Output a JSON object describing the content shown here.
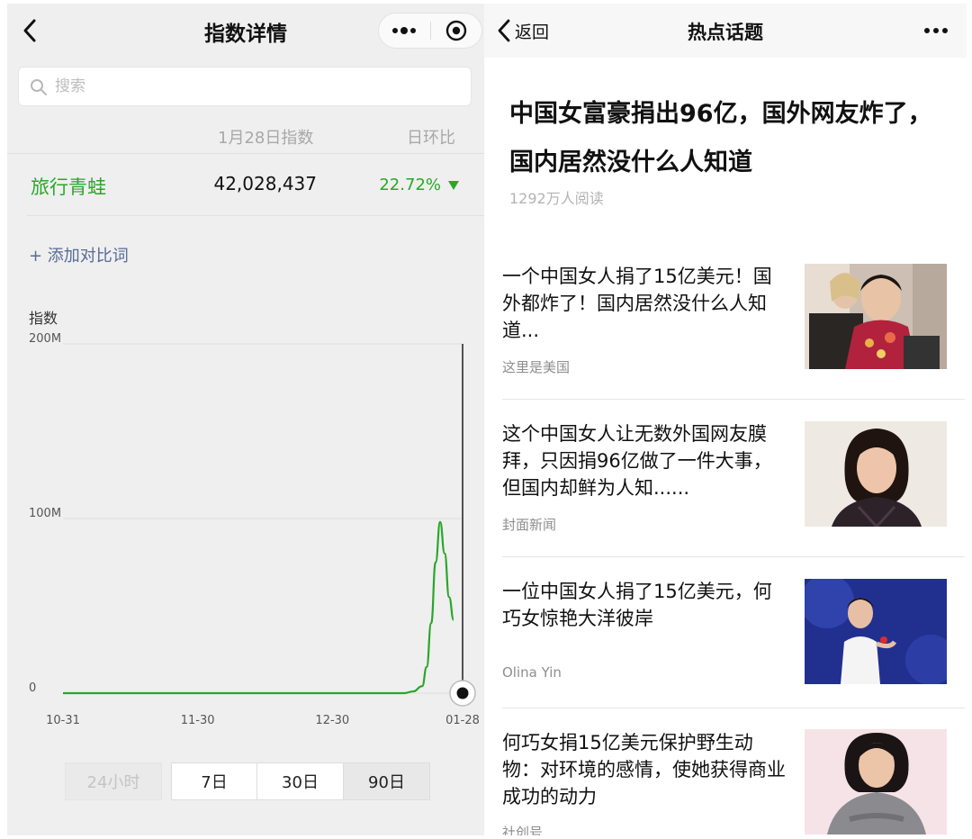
{
  "left": {
    "title": "指数详情",
    "search_placeholder": "搜索",
    "columns": {
      "date": "1月28日指数",
      "ratio": "日环比"
    },
    "row": {
      "term": "旅行青蛙",
      "index": "42,028,437",
      "ratio": "22.72%"
    },
    "add_compare": "+ 添加对比词",
    "y_axis_title": "指数",
    "range_buttons": [
      {
        "label": "24小时",
        "state": "disabled"
      },
      {
        "label": "7日",
        "state": "normal"
      },
      {
        "label": "30日",
        "state": "normal"
      },
      {
        "label": "90日",
        "state": "selected"
      }
    ]
  },
  "chart_data": {
    "type": "line",
    "ylabel": "指数",
    "ylim": [
      0,
      200000000
    ],
    "y_ticks": [
      {
        "label": "200M",
        "value": 200000000
      },
      {
        "label": "100M",
        "value": 100000000
      },
      {
        "label": "0",
        "value": 0
      }
    ],
    "x_ticks": [
      {
        "label": "10-31",
        "day": 0
      },
      {
        "label": "11-30",
        "day": 30
      },
      {
        "label": "12-30",
        "day": 60
      },
      {
        "label": "01-28",
        "day": 89
      }
    ],
    "xlim": [
      0,
      89
    ],
    "series": [
      {
        "color": "#2aa62a",
        "points": [
          [
            0,
            0
          ],
          [
            70,
            0
          ],
          [
            76,
            0
          ],
          [
            78,
            1000000
          ],
          [
            80,
            4000000
          ],
          [
            81,
            15000000
          ],
          [
            82,
            40000000
          ],
          [
            83,
            75000000
          ],
          [
            84,
            98000000
          ],
          [
            85,
            80000000
          ],
          [
            86,
            55000000
          ],
          [
            87,
            42000000
          ]
        ]
      }
    ],
    "highlight_day": 89,
    "grid": true
  },
  "right": {
    "back_label": "返回",
    "title": "热点话题",
    "headline": "中国女富豪捐出96亿，国外网友炸了，国内居然没什么人知道",
    "reads": "1292万人阅读",
    "articles": [
      {
        "title": "一个中国女人捐了15亿美元！国外都炸了！国内居然没什么人知道...",
        "source": "这里是美国"
      },
      {
        "title": "这个中国女人让无数外国网友膜拜，只因捐96亿做了一件大事，但国内却鲜为人知......",
        "source": "封面新闻"
      },
      {
        "title": "一位中国女人捐了15亿美元，何巧女惊艳大洋彼岸",
        "source": "Olina Yin"
      },
      {
        "title": "何巧女捐15亿美元保护野生动物：对环境的感情，使她获得商业成功的动力",
        "source": "社创号"
      }
    ]
  },
  "colors": {
    "accent_green": "#2aa62a",
    "link_blue": "#576b95"
  }
}
